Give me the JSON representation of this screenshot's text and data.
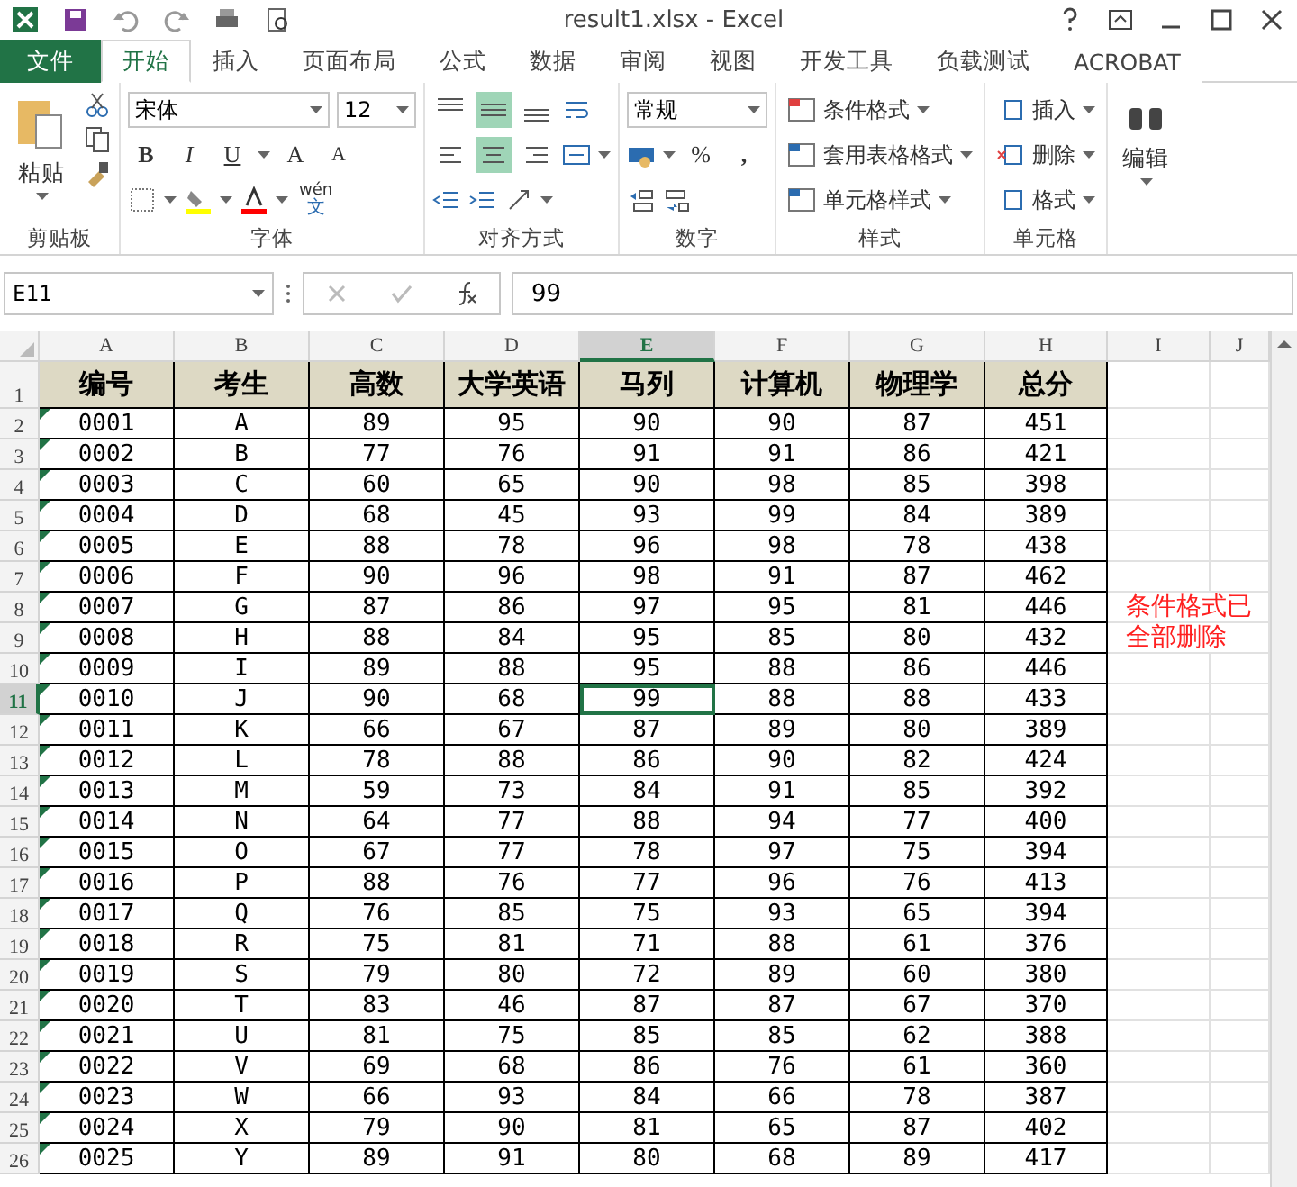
{
  "window": {
    "title": "result1.xlsx - Excel"
  },
  "tabs": [
    {
      "label": "文件",
      "kind": "file",
      "selected": false
    },
    {
      "label": "开始",
      "kind": "tab",
      "selected": true
    },
    {
      "label": "插入",
      "kind": "tab",
      "selected": false
    },
    {
      "label": "页面布局",
      "kind": "tab",
      "selected": false
    },
    {
      "label": "公式",
      "kind": "tab",
      "selected": false
    },
    {
      "label": "数据",
      "kind": "tab",
      "selected": false
    },
    {
      "label": "审阅",
      "kind": "tab",
      "selected": false
    },
    {
      "label": "视图",
      "kind": "tab",
      "selected": false
    },
    {
      "label": "开发工具",
      "kind": "tab",
      "selected": false
    },
    {
      "label": "负载测试",
      "kind": "tab",
      "selected": false
    },
    {
      "label": "ACROBAT",
      "kind": "tab",
      "selected": false
    }
  ],
  "ribbon": {
    "clipboard": {
      "title": "剪贴板",
      "paste": "粘贴"
    },
    "font": {
      "title": "字体",
      "name": "宋体",
      "size": "12",
      "bold": "B",
      "italic": "I",
      "underline": "U",
      "grow": "A",
      "shrink": "A",
      "phonetic_top": "wén",
      "phonetic_bottom": "文"
    },
    "alignment": {
      "title": "对齐方式",
      "vertical": [
        {
          "selected": false
        },
        {
          "selected": true
        },
        {
          "selected": false
        }
      ],
      "horizontal": [
        {
          "selected": false
        },
        {
          "selected": true
        },
        {
          "selected": false
        }
      ]
    },
    "number": {
      "title": "数字",
      "format": "常规",
      "percent": "%",
      "comma": ","
    },
    "styles": {
      "title": "样式",
      "items": [
        "条件格式",
        "套用表格格式",
        "单元格样式"
      ]
    },
    "cells": {
      "title": "单元格",
      "items": [
        "插入",
        "删除",
        "格式"
      ]
    },
    "editing": {
      "label": "编辑"
    }
  },
  "formula_bar": {
    "name_box": "E11",
    "formula": "99"
  },
  "columns": [
    {
      "label": "A",
      "selected": false
    },
    {
      "label": "B",
      "selected": false
    },
    {
      "label": "C",
      "selected": false
    },
    {
      "label": "D",
      "selected": false
    },
    {
      "label": "E",
      "selected": true
    },
    {
      "label": "F",
      "selected": false
    },
    {
      "label": "G",
      "selected": false
    },
    {
      "label": "H",
      "selected": false
    },
    {
      "label": "I",
      "selected": false
    },
    {
      "label": "J",
      "selected": false
    }
  ],
  "rows": [
    {
      "number": "1",
      "kind": "header",
      "selected": false,
      "cells": [
        "编号",
        "考生",
        "高数",
        "大学英语",
        "马列",
        "计算机",
        "物理学",
        "总分"
      ]
    },
    {
      "number": "2",
      "kind": "data",
      "selected": false,
      "marker": true,
      "cells": [
        "0001",
        "A",
        "89",
        "95",
        "90",
        "90",
        "87",
        "451"
      ]
    },
    {
      "number": "3",
      "kind": "data",
      "selected": false,
      "marker": true,
      "cells": [
        "0002",
        "B",
        "77",
        "76",
        "91",
        "91",
        "86",
        "421"
      ]
    },
    {
      "number": "4",
      "kind": "data",
      "selected": false,
      "marker": true,
      "cells": [
        "0003",
        "C",
        "60",
        "65",
        "90",
        "98",
        "85",
        "398"
      ]
    },
    {
      "number": "5",
      "kind": "data",
      "selected": false,
      "marker": true,
      "cells": [
        "0004",
        "D",
        "68",
        "45",
        "93",
        "99",
        "84",
        "389"
      ]
    },
    {
      "number": "6",
      "kind": "data",
      "selected": false,
      "marker": true,
      "cells": [
        "0005",
        "E",
        "88",
        "78",
        "96",
        "98",
        "78",
        "438"
      ]
    },
    {
      "number": "7",
      "kind": "data",
      "selected": false,
      "marker": true,
      "cells": [
        "0006",
        "F",
        "90",
        "96",
        "98",
        "91",
        "87",
        "462"
      ]
    },
    {
      "number": "8",
      "kind": "data",
      "selected": false,
      "marker": true,
      "note": "条件格式已",
      "cells": [
        "0007",
        "G",
        "87",
        "86",
        "97",
        "95",
        "81",
        "446"
      ]
    },
    {
      "number": "9",
      "kind": "data",
      "selected": false,
      "marker": true,
      "note": "全部删除",
      "cells": [
        "0008",
        "H",
        "88",
        "84",
        "95",
        "85",
        "80",
        "432"
      ]
    },
    {
      "number": "10",
      "kind": "data",
      "selected": false,
      "marker": true,
      "cells": [
        "0009",
        "I",
        "89",
        "88",
        "95",
        "88",
        "86",
        "446"
      ]
    },
    {
      "number": "11",
      "kind": "data",
      "selected": true,
      "marker": true,
      "cells": [
        "0010",
        "J",
        "90",
        "68",
        "99",
        "88",
        "88",
        "433"
      ]
    },
    {
      "number": "12",
      "kind": "data",
      "selected": false,
      "marker": true,
      "cells": [
        "0011",
        "K",
        "66",
        "67",
        "87",
        "89",
        "80",
        "389"
      ]
    },
    {
      "number": "13",
      "kind": "data",
      "selected": false,
      "marker": true,
      "cells": [
        "0012",
        "L",
        "78",
        "88",
        "86",
        "90",
        "82",
        "424"
      ]
    },
    {
      "number": "14",
      "kind": "data",
      "selected": false,
      "marker": true,
      "cells": [
        "0013",
        "M",
        "59",
        "73",
        "84",
        "91",
        "85",
        "392"
      ]
    },
    {
      "number": "15",
      "kind": "data",
      "selected": false,
      "marker": true,
      "cells": [
        "0014",
        "N",
        "64",
        "77",
        "88",
        "94",
        "77",
        "400"
      ]
    },
    {
      "number": "16",
      "kind": "data",
      "selected": false,
      "marker": true,
      "cells": [
        "0015",
        "O",
        "67",
        "77",
        "78",
        "97",
        "75",
        "394"
      ]
    },
    {
      "number": "17",
      "kind": "data",
      "selected": false,
      "marker": true,
      "cells": [
        "0016",
        "P",
        "88",
        "76",
        "77",
        "96",
        "76",
        "413"
      ]
    },
    {
      "number": "18",
      "kind": "data",
      "selected": false,
      "marker": true,
      "cells": [
        "0017",
        "Q",
        "76",
        "85",
        "75",
        "93",
        "65",
        "394"
      ]
    },
    {
      "number": "19",
      "kind": "data",
      "selected": false,
      "marker": true,
      "cells": [
        "0018",
        "R",
        "75",
        "81",
        "71",
        "88",
        "61",
        "376"
      ]
    },
    {
      "number": "20",
      "kind": "data",
      "selected": false,
      "marker": true,
      "cells": [
        "0019",
        "S",
        "79",
        "80",
        "72",
        "89",
        "60",
        "380"
      ]
    },
    {
      "number": "21",
      "kind": "data",
      "selected": false,
      "marker": true,
      "cells": [
        "0020",
        "T",
        "83",
        "46",
        "87",
        "87",
        "67",
        "370"
      ]
    },
    {
      "number": "22",
      "kind": "data",
      "selected": false,
      "marker": true,
      "cells": [
        "0021",
        "U",
        "81",
        "75",
        "85",
        "85",
        "62",
        "388"
      ]
    },
    {
      "number": "23",
      "kind": "data",
      "selected": false,
      "marker": true,
      "cells": [
        "0022",
        "V",
        "69",
        "68",
        "86",
        "76",
        "61",
        "360"
      ]
    },
    {
      "number": "24",
      "kind": "data",
      "selected": false,
      "marker": true,
      "cells": [
        "0023",
        "W",
        "66",
        "93",
        "84",
        "66",
        "78",
        "387"
      ]
    },
    {
      "number": "25",
      "kind": "data",
      "selected": false,
      "marker": true,
      "cells": [
        "0024",
        "X",
        "79",
        "90",
        "81",
        "65",
        "87",
        "402"
      ]
    },
    {
      "number": "26",
      "kind": "data",
      "selected": false,
      "marker": true,
      "cells": [
        "0025",
        "Y",
        "89",
        "91",
        "80",
        "68",
        "89",
        "417"
      ]
    }
  ]
}
